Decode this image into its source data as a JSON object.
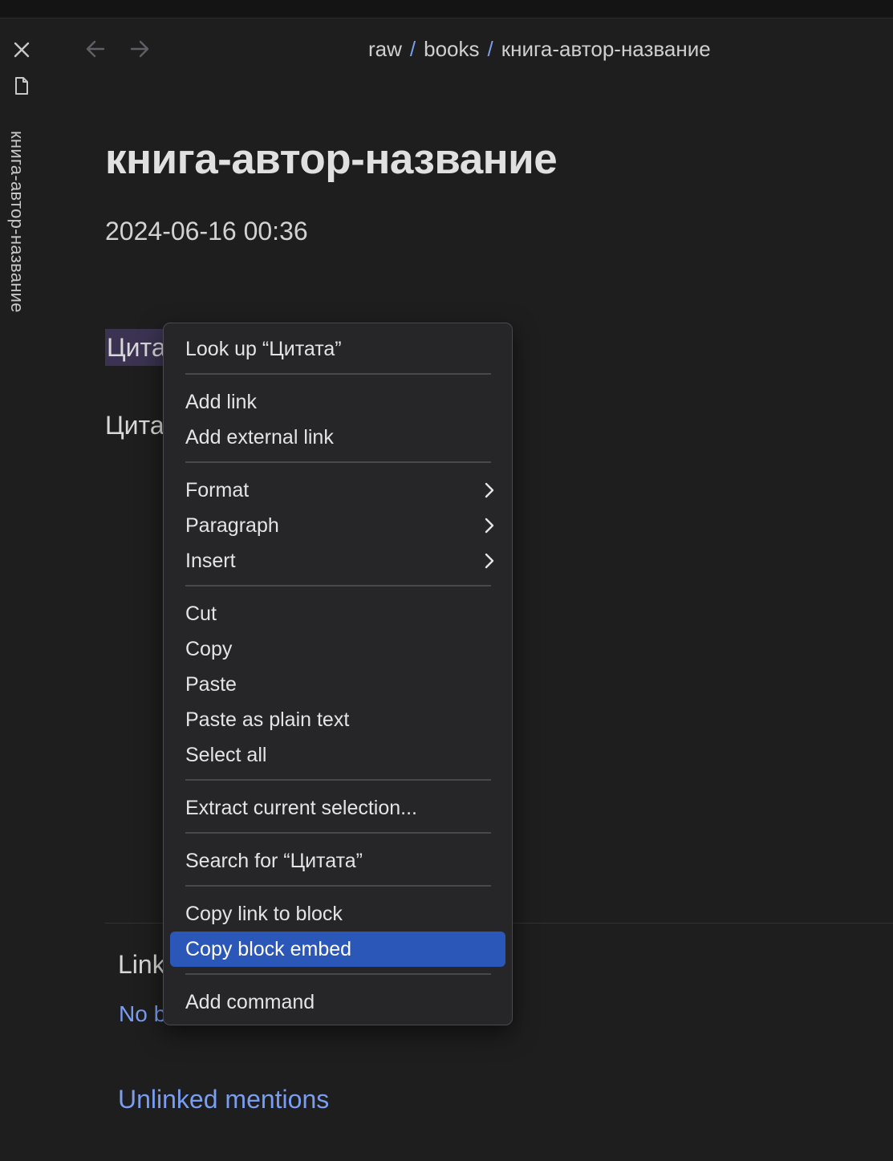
{
  "sidebar": {
    "tab_label": "книга-автор-название",
    "icons": [
      "close-icon",
      "file-icon"
    ]
  },
  "nav": {
    "back_icon": "arrow-left-icon",
    "forward_icon": "arrow-right-icon"
  },
  "breadcrumb": {
    "parts": [
      "raw",
      "books",
      "книга-автор-название"
    ],
    "separator": "/"
  },
  "note": {
    "title": "книга-автор-название",
    "date": "2024-06-16 00:36",
    "line1_visible": "Цита",
    "line2_visible": "Цита"
  },
  "backlinks": {
    "heading_visible": "Link",
    "empty_visible": "No b",
    "unlinked_label": "Unlinked mentions"
  },
  "context_menu": {
    "items": [
      {
        "label": "Look up “Цитата”"
      },
      {
        "label": "Add link"
      },
      {
        "label": "Add external link"
      },
      {
        "label": "Format",
        "submenu": true
      },
      {
        "label": "Paragraph",
        "submenu": true
      },
      {
        "label": "Insert",
        "submenu": true
      },
      {
        "label": "Cut"
      },
      {
        "label": "Copy"
      },
      {
        "label": "Paste"
      },
      {
        "label": "Paste as plain text"
      },
      {
        "label": "Select all"
      },
      {
        "label": "Extract current selection..."
      },
      {
        "label": "Search for “Цитата”"
      },
      {
        "label": "Copy link to block"
      },
      {
        "label": "Copy block embed",
        "highlighted": true
      },
      {
        "label": "Add command"
      }
    ]
  },
  "colors": {
    "background": "#1e1e1e",
    "accent": "#7a9df0",
    "menu_highlight": "#2b57b8",
    "selection": "#3b3351"
  }
}
